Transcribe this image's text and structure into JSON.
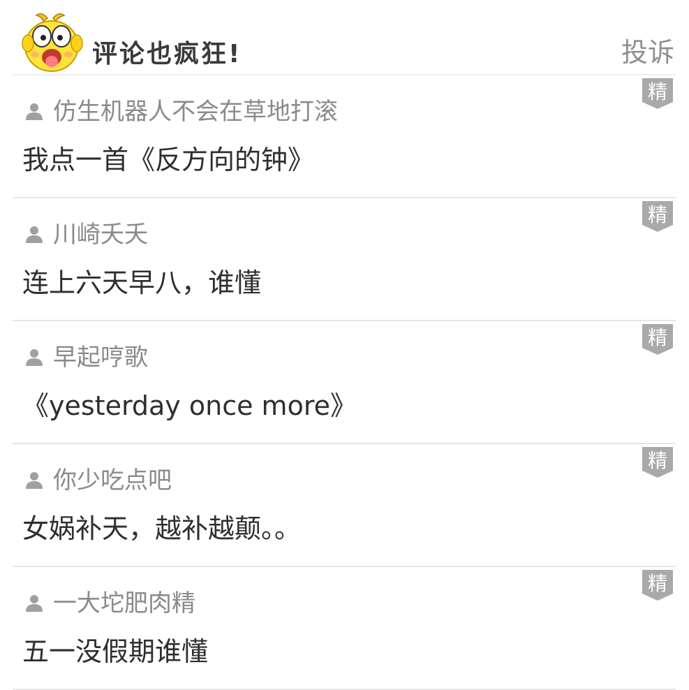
{
  "header": {
    "title": "评论也疯狂!",
    "report_label": "投诉",
    "mascot_icon": "yellow-chick-mascot-icon"
  },
  "badge_label": "精",
  "colors": {
    "badge": "#a9a9a9",
    "author": "#8a8a8a",
    "text": "#2e2e2e",
    "divider": "#e6e6e6"
  },
  "comments": [
    {
      "author": "仿生机器人不会在草地打滚",
      "text": "我点一首《反方向的钟》"
    },
    {
      "author": "川崎夭夭",
      "text": "连上六天早八，谁懂"
    },
    {
      "author": "早起哼歌",
      "text": "《yesterday once more》"
    },
    {
      "author": "你少吃点吧",
      "text": "女娲补天，越补越颠。。"
    },
    {
      "author": "一大坨肥肉精",
      "text": "五一没假期谁懂"
    }
  ]
}
